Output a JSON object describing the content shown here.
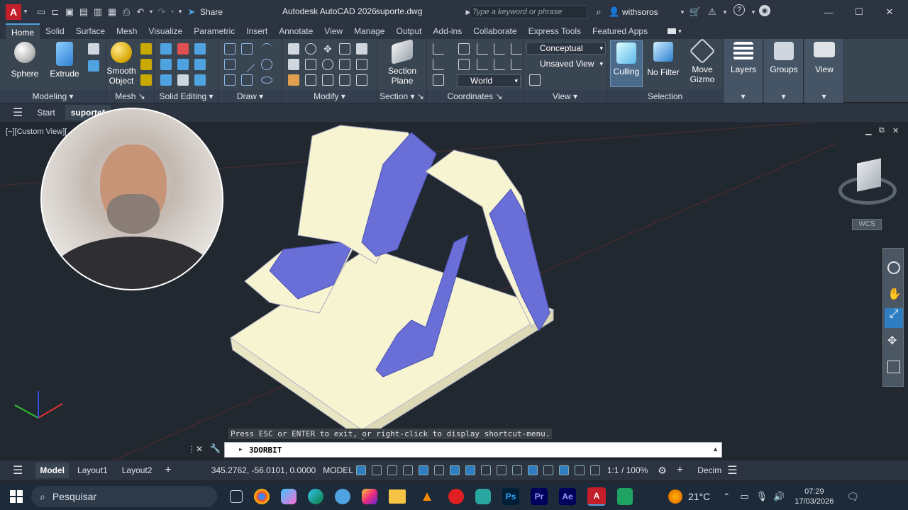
{
  "titlebar": {
    "app_title": "Autodesk AutoCAD 2026",
    "file_name": "suporte.dwg",
    "share_label": "Share",
    "search_placeholder": "Type a keyword or phrase",
    "user_name": "withsoros",
    "app_logo": "A"
  },
  "tabs": [
    "Home",
    "Solid",
    "Surface",
    "Mesh",
    "Visualize",
    "Parametric",
    "Insert",
    "Annotate",
    "View",
    "Manage",
    "Output",
    "Add-ins",
    "Collaborate",
    "Express Tools",
    "Featured Apps"
  ],
  "ribbon": {
    "sphere": "Sphere",
    "extrude": "Extrude",
    "smooth_object_1": "Smooth",
    "smooth_object_2": "Object",
    "section_plane_1": "Section",
    "section_plane_2": "Plane",
    "visual_style": "Conceptual",
    "saved_view": "Unsaved View",
    "ucs": "World",
    "culling": "Culling",
    "no_filter": "No Filter",
    "move_gizmo_1": "Move",
    "move_gizmo_2": "Gizmo",
    "layers": "Layers",
    "groups": "Groups",
    "view": "View",
    "panels": {
      "modeling": "Modeling",
      "mesh": "Mesh",
      "solid_editing": "Solid Editing",
      "draw": "Draw",
      "modify": "Modify",
      "section": "Section",
      "coordinates": "Coordinates",
      "view": "View",
      "selection": "Selection"
    }
  },
  "filetabs": {
    "start": "Start",
    "current": "suporte*"
  },
  "viewport": {
    "label": "[−][Custom View][",
    "wcs": "WCS",
    "command_prompt": "Press ESC or ENTER to exit, or right-click to display shortcut-menu.",
    "command_value": "3DORBIT"
  },
  "statusbar": {
    "model_tab": "Model",
    "layout1": "Layout1",
    "layout2": "Layout2",
    "coords": "345.2762, -56.0101, 0.0000",
    "model_space": "MODEL",
    "scale": "1:1 / 100%",
    "units": "Decim"
  },
  "taskbar": {
    "search_label": "Pesquisar",
    "temperature": "21°C",
    "time": "07:29",
    "date": "17/03/2026"
  },
  "colors": {
    "accent": "#4fa3e0",
    "viewport_bg": "#212830",
    "model_fill": "#f7f4d2",
    "model_section": "#6a6fd8",
    "autocad_red": "#c41e2a"
  }
}
